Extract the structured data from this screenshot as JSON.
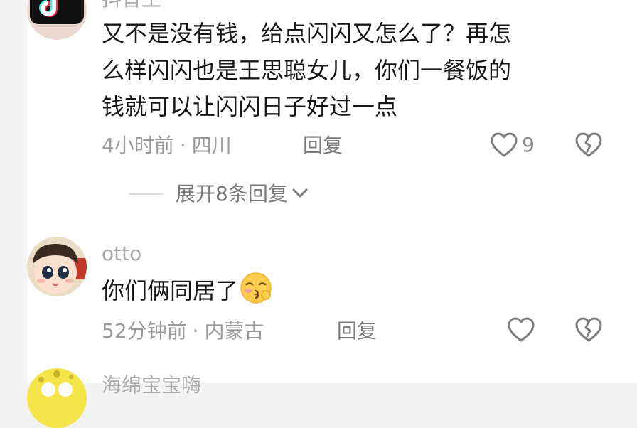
{
  "comments": [
    {
      "username": "抖音王",
      "text_lines": [
        "又不是没有钱，给点闪闪又怎么了？再怎",
        "么样闪闪也是王思聪女儿，你们一餐饭的",
        "钱就可以让闪闪日子好过一点"
      ],
      "time": "4小时前",
      "location": "四川",
      "reply_label": "回复",
      "like_count": "9",
      "avatar_icon": "tiktok-logo-avatar"
    },
    {
      "username": "otto",
      "text": "你们俩同居了",
      "emoji_icon": "kissing-face-emoji",
      "time": "52分钟前",
      "location": "内蒙古",
      "reply_label": "回复",
      "like_count": "",
      "avatar_icon": "cartoon-baby-avatar"
    },
    {
      "username": "海绵宝宝嗨",
      "avatar_icon": "spongebob-avatar"
    }
  ],
  "expand_replies": {
    "label": "展开8条回复"
  },
  "separator_dot": "·",
  "colors": {
    "text_primary": "#161616",
    "text_secondary": "#9a9a9a",
    "divider": "#dcdcdc",
    "background": "#ffffff"
  }
}
